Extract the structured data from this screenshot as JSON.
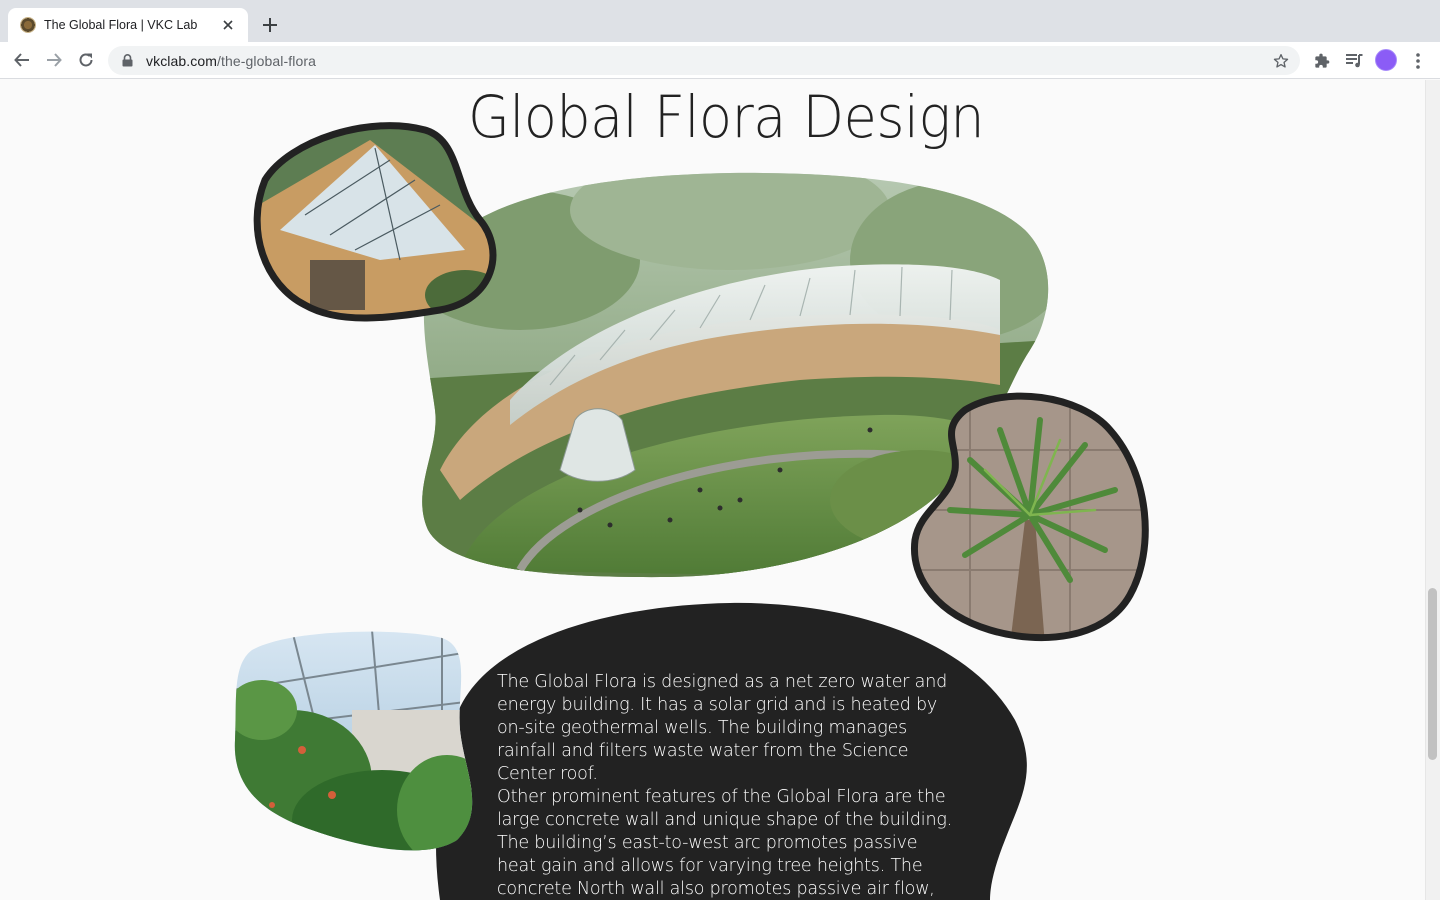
{
  "browser": {
    "tab_title": "The Global Flora | VKC Lab",
    "url_domain": "vkclab.com",
    "url_path": "/the-global-flora"
  },
  "page": {
    "title": "Global Flora Design",
    "paragraphs": [
      "The Global Flora is designed as a net zero water and energy building. It has a solar grid and is heated by on-site geothermal wells. The building manages rainfall and filters waste water from the Science Center roof.",
      "Other prominent features of the Global Flora are the large concrete wall and unique shape of the building. The building’s east-to-west arc promotes passive heat gain and allows for varying tree heights. The concrete North wall also promotes passive air flow, heat, and"
    ]
  },
  "icons": {
    "back": "arrow-left-icon",
    "forward": "arrow-right-icon",
    "reload": "reload-icon",
    "lock": "lock-icon",
    "bookmark": "star-icon",
    "extensions": "puzzle-icon",
    "media": "queue-music-icon",
    "menu": "kebab-menu-icon"
  },
  "colors": {
    "dark_blob": "#222222",
    "page_bg": "#fafafa",
    "tabstrip": "#dee1e6"
  }
}
